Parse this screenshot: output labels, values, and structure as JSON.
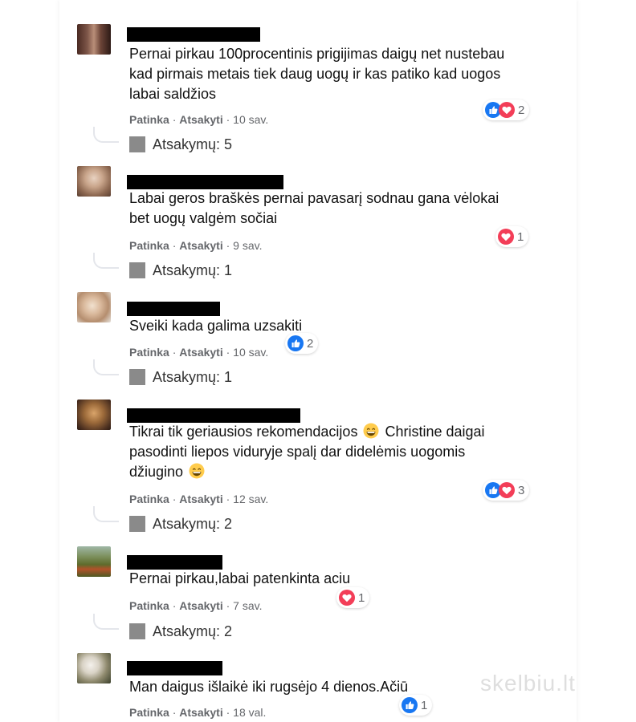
{
  "comments": [
    {
      "text": "Pernai pirkau 100procentinis prigijimas daigų net nustebau kad pirmais metais tiek daug uogų ir kas patiko kad uogos labai saldžios",
      "like": "Patinka",
      "reply": "Atsakyti",
      "time": "· 10 sav.",
      "reaction_count": "2",
      "replies": "Atsakymų: 5"
    },
    {
      "text": "Labai geros braškės pernai pavasarį sodnau gana vėlokai bet uogų valgėm sočiai",
      "like": "Patinka",
      "reply": "Atsakyti",
      "time": "· 9 sav.",
      "reaction_count": "1",
      "replies": "Atsakymų: 1"
    },
    {
      "text": "Sveiki kada galima uzsakiti",
      "like": "Patinka",
      "reply": "Atsakyti",
      "time": "· 10 sav.",
      "reaction_count": "2",
      "replies": "Atsakymų: 1"
    },
    {
      "text_a": "Tikrai tik geriausios rekomendacijos",
      "text_b": "Christine daigai pasodinti liepos viduryje spalį dar didelėmis uogomis džiugino",
      "like": "Patinka",
      "reply": "Atsakyti",
      "time": "· 12 sav.",
      "reaction_count": "3",
      "replies": "Atsakymų: 2"
    },
    {
      "text": "Pernai pirkau,labai patenkinta aciu",
      "like": "Patinka",
      "reply": "Atsakyti",
      "time": "· 7 sav.",
      "reaction_count": "1",
      "replies": "Atsakymų: 2"
    },
    {
      "text": "Man daigus išlaikė iki rugsėjo 4 dienos.Ačiū",
      "like": "Patinka",
      "reply": "Atsakyti",
      "time": "· 18 val.",
      "reaction_count": "1"
    }
  ],
  "watermark": "skelbiu.lt",
  "icons": {
    "like": "like-reaction-icon",
    "love": "love-reaction-icon",
    "grin": "grinning-emoji-icon",
    "reply_thumb": "reply-thumbnail-icon"
  },
  "colors": {
    "like_blue": "#1877f2",
    "love_red": "#f33e58",
    "meta_gray": "#65676b",
    "name_redaction": "#000000"
  }
}
